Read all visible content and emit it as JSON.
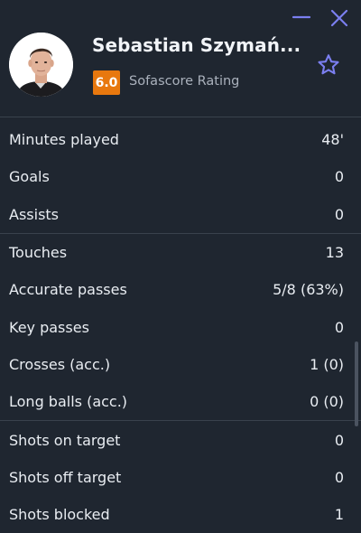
{
  "window": {
    "minimize_icon": "minimize-icon",
    "close_icon": "close-icon"
  },
  "player": {
    "name": "Sebastian Szymań...",
    "rating": "6.0",
    "rating_label": "Sofascore Rating",
    "rating_color": "#e8780e",
    "favorite_icon": "star-outline-icon"
  },
  "accent_color": "#7b7ff0",
  "stats_groups": [
    [
      {
        "label": "Minutes played",
        "value": "48'"
      },
      {
        "label": "Goals",
        "value": "0"
      },
      {
        "label": "Assists",
        "value": "0"
      }
    ],
    [
      {
        "label": "Touches",
        "value": "13"
      },
      {
        "label": "Accurate passes",
        "value": "5/8 (63%)"
      },
      {
        "label": "Key passes",
        "value": "0"
      },
      {
        "label": "Crosses (acc.)",
        "value": "1 (0)"
      },
      {
        "label": "Long balls (acc.)",
        "value": "0 (0)"
      }
    ],
    [
      {
        "label": "Shots on target",
        "value": "0"
      },
      {
        "label": "Shots off target",
        "value": "0"
      },
      {
        "label": "Shots blocked",
        "value": "1"
      }
    ]
  ]
}
